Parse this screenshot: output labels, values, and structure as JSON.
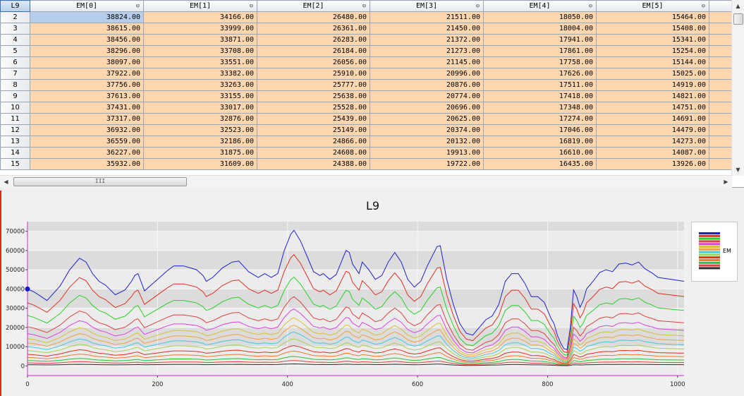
{
  "grid": {
    "corner_label": "L9",
    "columns": [
      "EM[0]",
      "EM[1]",
      "EM[2]",
      "EM[3]",
      "EM[4]",
      "EM[5]"
    ],
    "sort_glyph": "⊖",
    "rows": [
      {
        "label": "2",
        "values": [
          "38824.00",
          "34166.00",
          "26480.00",
          "21511.00",
          "18050.00",
          "15464.00"
        ]
      },
      {
        "label": "3",
        "values": [
          "38615.00",
          "33999.00",
          "26361.00",
          "21450.00",
          "18004.00",
          "15408.00"
        ]
      },
      {
        "label": "4",
        "values": [
          "38456.00",
          "33871.00",
          "26283.00",
          "21372.00",
          "17941.00",
          "15341.00"
        ]
      },
      {
        "label": "5",
        "values": [
          "38296.00",
          "33708.00",
          "26184.00",
          "21273.00",
          "17861.00",
          "15254.00"
        ]
      },
      {
        "label": "6",
        "values": [
          "38097.00",
          "33551.00",
          "26056.00",
          "21145.00",
          "17758.00",
          "15144.00"
        ]
      },
      {
        "label": "7",
        "values": [
          "37922.00",
          "33382.00",
          "25910.00",
          "20996.00",
          "17626.00",
          "15025.00"
        ]
      },
      {
        "label": "8",
        "values": [
          "37756.00",
          "33263.00",
          "25777.00",
          "20876.00",
          "17511.00",
          "14919.00"
        ]
      },
      {
        "label": "9",
        "values": [
          "37613.00",
          "33155.00",
          "25638.00",
          "20774.00",
          "17418.00",
          "14821.00"
        ]
      },
      {
        "label": "10",
        "values": [
          "37431.00",
          "33017.00",
          "25528.00",
          "20696.00",
          "17348.00",
          "14751.00"
        ]
      },
      {
        "label": "11",
        "values": [
          "37317.00",
          "32876.00",
          "25439.00",
          "20625.00",
          "17274.00",
          "14691.00"
        ]
      },
      {
        "label": "12",
        "values": [
          "36932.00",
          "32523.00",
          "25149.00",
          "20374.00",
          "17046.00",
          "14479.00"
        ]
      },
      {
        "label": "13",
        "values": [
          "36559.00",
          "32186.00",
          "24866.00",
          "20132.00",
          "16819.00",
          "14273.00"
        ]
      },
      {
        "label": "14",
        "values": [
          "36227.00",
          "31875.00",
          "24608.00",
          "19913.00",
          "16610.00",
          "14087.00"
        ]
      },
      {
        "label": "15",
        "values": [
          "35932.00",
          "31609.00",
          "24388.00",
          "19722.00",
          "16435.00",
          "13926.00"
        ]
      }
    ]
  },
  "scroll": {
    "up": "▲",
    "down": "▼",
    "left": "◀",
    "right": "▶",
    "grip": "III"
  },
  "chart_data": {
    "type": "line",
    "title": "L9",
    "xlim": [
      0,
      1010
    ],
    "ylim": [
      -5000,
      75000
    ],
    "x_ticks": [
      0,
      200,
      400,
      600,
      800,
      1000
    ],
    "y_ticks": [
      0,
      10000,
      20000,
      30000,
      40000,
      50000,
      60000,
      70000
    ],
    "legend": {
      "label": "EM",
      "placement": "right"
    },
    "envelope_x": [
      0,
      10,
      30,
      50,
      65,
      80,
      90,
      100,
      110,
      120,
      135,
      150,
      160,
      165,
      170,
      180,
      200,
      215,
      225,
      240,
      250,
      260,
      270,
      275,
      285,
      300,
      315,
      325,
      340,
      355,
      365,
      375,
      385,
      395,
      405,
      410,
      420,
      430,
      440,
      450,
      455,
      465,
      475,
      485,
      490,
      495,
      500,
      510,
      515,
      525,
      535,
      545,
      555,
      565,
      575,
      585,
      595,
      605,
      615,
      630,
      635,
      645,
      655,
      665,
      675,
      685,
      695,
      705,
      715,
      725,
      735,
      745,
      755,
      765,
      775,
      785,
      795,
      805,
      810,
      815,
      820,
      825,
      830,
      835,
      840,
      845,
      850,
      855,
      860,
      870,
      880,
      890,
      900,
      910,
      920,
      930,
      940,
      950,
      960,
      970,
      1010
    ],
    "envelope_y": [
      40000,
      38500,
      34000,
      41500,
      50000,
      56000,
      54000,
      48000,
      44000,
      42000,
      37000,
      39500,
      44000,
      47000,
      48000,
      39000,
      45000,
      49500,
      52000,
      52000,
      51000,
      50000,
      47000,
      44000,
      46000,
      51000,
      54000,
      54500,
      49000,
      46000,
      48000,
      46000,
      48000,
      60000,
      68500,
      70500,
      65000,
      57000,
      49000,
      47000,
      48000,
      45000,
      47500,
      56000,
      60000,
      59000,
      53000,
      48000,
      54000,
      50000,
      45000,
      47000,
      54000,
      59000,
      54000,
      45000,
      41000,
      44000,
      52000,
      62000,
      62500,
      45000,
      32000,
      22000,
      17000,
      16000,
      20000,
      24000,
      26000,
      32000,
      44000,
      48000,
      48000,
      43000,
      36000,
      36000,
      33000,
      25000,
      22000,
      16000,
      12000,
      9000,
      8500,
      20000,
      39500,
      36000,
      30500,
      34000,
      40000,
      44000,
      48500,
      50000,
      49000,
      53000,
      53500,
      52500,
      54000,
      50500,
      48500,
      46000,
      44000
    ],
    "series": [
      {
        "scale": 1.0,
        "color": "#1f1fd0"
      },
      {
        "scale": 0.82,
        "color": "#e03020"
      },
      {
        "scale": 0.655,
        "color": "#28d028"
      },
      {
        "scale": 0.51,
        "color": "#e04040"
      },
      {
        "scale": 0.42,
        "color": "#e040e0"
      },
      {
        "scale": 0.355,
        "color": "#d8c038"
      },
      {
        "scale": 0.3,
        "color": "#f0a040"
      },
      {
        "scale": 0.25,
        "color": "#40c8e0"
      },
      {
        "scale": 0.2,
        "color": "#a8d050"
      },
      {
        "scale": 0.15,
        "color": "#e03020"
      },
      {
        "scale": 0.11,
        "color": "#f07a30"
      },
      {
        "scale": 0.07,
        "color": "#30c030"
      },
      {
        "scale": 0.04,
        "color": "#e04040"
      },
      {
        "scale": 0.015,
        "color": "#303030"
      }
    ],
    "colors": {
      "grid_band": "#dcdcdc",
      "plot_bg": "#ececec",
      "axis": "#e020e0",
      "cursor": "#1010e0"
    }
  }
}
